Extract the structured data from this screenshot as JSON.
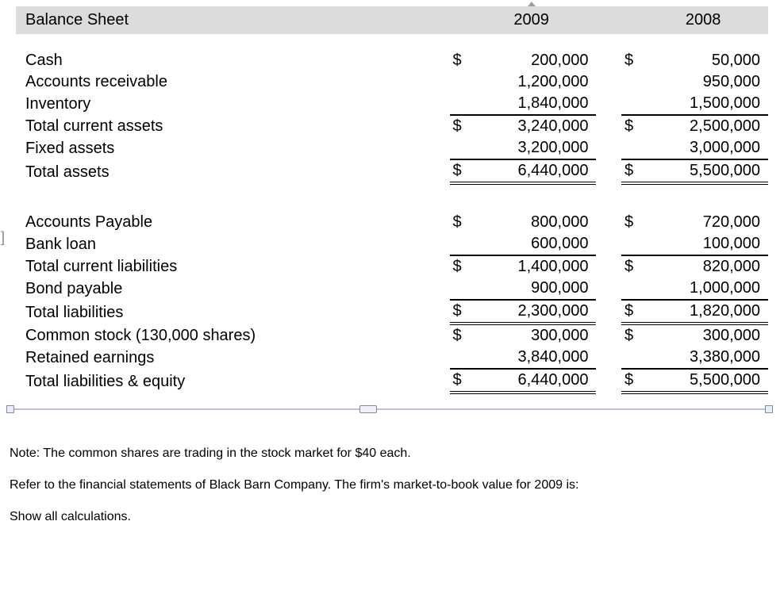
{
  "header": {
    "title": "Balance Sheet",
    "y1": "2009",
    "y2": "2008"
  },
  "rows": [
    {
      "label": "Cash",
      "c1": "$",
      "v1": "200,000",
      "c2": "$",
      "v2": "50,000"
    },
    {
      "label": "Accounts receivable",
      "c1": "",
      "v1": "1,200,000",
      "c2": "",
      "v2": "950,000"
    },
    {
      "label": "Inventory",
      "c1": "",
      "v1": "1,840,000",
      "c2": "",
      "v2": "1,500,000"
    },
    {
      "label": "Total current assets",
      "c1": "$",
      "v1": "3,240,000",
      "c2": "$",
      "v2": "2,500,000"
    },
    {
      "label": "Fixed assets",
      "c1": "",
      "v1": "3,200,000",
      "c2": "",
      "v2": "3,000,000"
    },
    {
      "label": "Total assets",
      "c1": "$",
      "v1": "6,440,000",
      "c2": "$",
      "v2": "5,500,000"
    },
    {
      "label": "Accounts Payable",
      "c1": "$",
      "v1": "800,000",
      "c2": "$",
      "v2": "720,000"
    },
    {
      "label": "Bank loan",
      "c1": "",
      "v1": "600,000",
      "c2": "",
      "v2": "100,000"
    },
    {
      "label": "Total current liabilities",
      "c1": "$",
      "v1": "1,400,000",
      "c2": "$",
      "v2": "820,000"
    },
    {
      "label": "Bond payable",
      "c1": "",
      "v1": "900,000",
      "c2": "",
      "v2": "1,000,000"
    },
    {
      "label": "Total liabilities",
      "c1": "$",
      "v1": "2,300,000",
      "c2": "$",
      "v2": "1,820,000"
    },
    {
      "label": "Common stock (130,000 shares)",
      "c1": "$",
      "v1": "300,000",
      "c2": "$",
      "v2": "300,000"
    },
    {
      "label": "Retained earnings",
      "c1": "",
      "v1": "3,840,000",
      "c2": "",
      "v2": "3,380,000"
    },
    {
      "label": "Total liabilities & equity",
      "c1": "$",
      "v1": "6,440,000",
      "c2": "$",
      "v2": "5,500,000"
    }
  ],
  "notes": {
    "n1": "Note: The common shares are trading in the stock market for $40 each.",
    "n2": "Refer to the financial statements of Black Barn Company. The firm's market-to-book value for 2009 is:",
    "n3": "Show all calculations."
  }
}
